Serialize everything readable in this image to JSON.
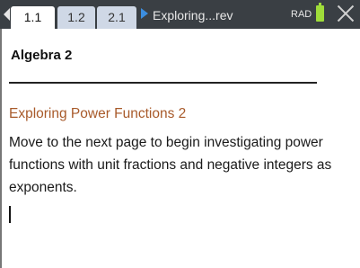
{
  "tabs": [
    {
      "label": "1.1",
      "active": true
    },
    {
      "label": "1.2",
      "active": false
    },
    {
      "label": "2.1",
      "active": false
    }
  ],
  "document_title": "Exploring...rev",
  "angle_mode": "RAD",
  "page": {
    "heading": "Algebra 2",
    "subtitle": "Exploring Power Functions 2",
    "body": "Move to the next page to begin investigating power functions with unit fractions and negative integers as exponents."
  },
  "colors": {
    "toolbar": "#3a3f44",
    "active_tab": "#ffffff",
    "inactive_tab": "#cfd8e6",
    "subtitle": "#a85a2a",
    "battery": "#9fdc3a",
    "nav_arrow": "#3c8ee0"
  },
  "icons": [
    "chevron-left-icon",
    "chevron-right-icon",
    "battery-icon",
    "close-icon"
  ]
}
